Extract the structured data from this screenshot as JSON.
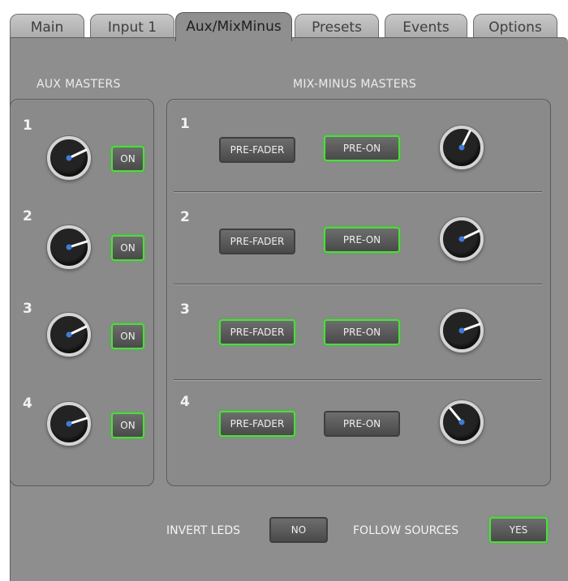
{
  "tabs": [
    {
      "label": "Main",
      "active": false
    },
    {
      "label": "Input 1",
      "active": false
    },
    {
      "label": "Aux/MixMinus",
      "active": true
    },
    {
      "label": "Presets",
      "active": false
    },
    {
      "label": "Events",
      "active": false
    },
    {
      "label": "Options",
      "active": false
    }
  ],
  "aux": {
    "title": "AUX MASTERS",
    "channels": [
      {
        "number": "1",
        "button": "ON",
        "button_on": true
      },
      {
        "number": "2",
        "button": "ON",
        "button_on": true
      },
      {
        "number": "3",
        "button": "ON",
        "button_on": true
      },
      {
        "number": "4",
        "button": "ON",
        "button_on": true
      }
    ]
  },
  "mixminus": {
    "title": "MIX-MINUS MASTERS",
    "channels": [
      {
        "number": "1",
        "prefader": "PRE-FADER",
        "prefader_on": false,
        "preon": "PRE-ON",
        "preon_on": true
      },
      {
        "number": "2",
        "prefader": "PRE-FADER",
        "prefader_on": false,
        "preon": "PRE-ON",
        "preon_on": true
      },
      {
        "number": "3",
        "prefader": "PRE-FADER",
        "prefader_on": true,
        "preon": "PRE-ON",
        "preon_on": true
      },
      {
        "number": "4",
        "prefader": "PRE-FADER",
        "prefader_on": true,
        "preon": "PRE-ON",
        "preon_on": false
      }
    ]
  },
  "footer": {
    "invert_leds_label": "INVERT LEDS",
    "invert_leds_value": "NO",
    "invert_leds_on": false,
    "follow_sources_label": "FOLLOW SOURCES",
    "follow_sources_value": "YES",
    "follow_sources_on": true
  },
  "colors": {
    "active_led_border": "#4fdc3e",
    "panel_bg": "#8e8e8e",
    "knob_pointer": "#3f7bd9"
  }
}
